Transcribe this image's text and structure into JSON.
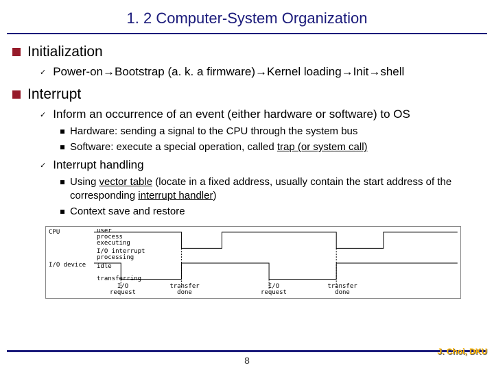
{
  "title": "1. 2 Computer-System Organization",
  "sections": [
    {
      "heading": "Initialization",
      "items": [
        {
          "text": "Power-on→Bootstrap (a. k. a firmware)→Kernel loading→Init→shell"
        }
      ]
    },
    {
      "heading": "Interrupt",
      "items": [
        {
          "text": "Inform an occurrence of an event (either hardware or software) to OS",
          "sub": [
            {
              "plain": "Hardware: sending a signal to the CPU through the system bus"
            },
            {
              "prefix": "Software: execute a special operation, called ",
              "ul": "trap (or system call)"
            }
          ]
        },
        {
          "text": "Interrupt handling",
          "sub": [
            {
              "prefix": "Using ",
              "ul": "vector table",
              "mid": " (locate in a fixed address, usually contain the start address of the corresponding ",
              "ul2": "interrupt handler",
              "suffix": ")"
            },
            {
              "plain": "Context save and restore"
            }
          ]
        }
      ]
    }
  ],
  "diagram": {
    "rows": [
      "CPU",
      "I/O\ndevice"
    ],
    "cpu_states": [
      "user\nprocess\nexecuting",
      "I/O interrupt\nprocessing"
    ],
    "io_states": [
      "idle",
      "transferring"
    ],
    "events": [
      "I/O\nrequest",
      "transfer\ndone",
      "I/O\nrequest",
      "transfer\ndone"
    ]
  },
  "page_number": "8",
  "credit": "J. Choi, DKU"
}
